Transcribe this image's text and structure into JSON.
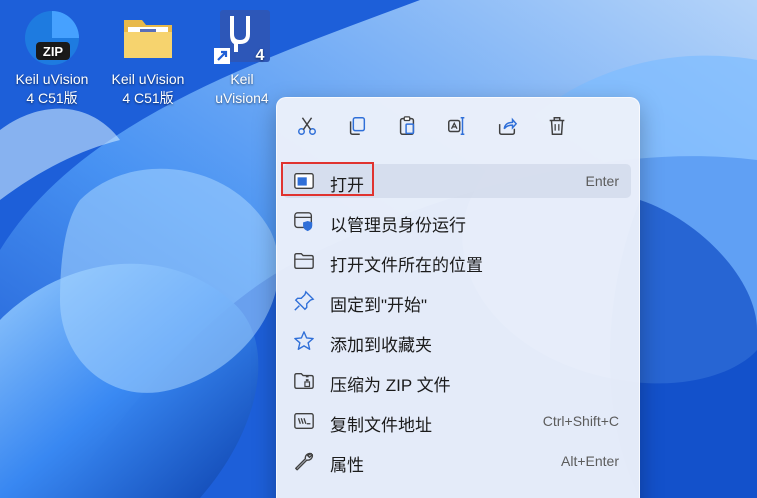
{
  "desktop": {
    "icons": [
      {
        "label": "Keil uVision\n4 C51版",
        "type": "zip-archive"
      },
      {
        "label": "Keil uVision\n4 C51版",
        "type": "folder"
      },
      {
        "label": "Keil\nuVision4",
        "type": "keil-shortcut",
        "badge": "4"
      }
    ]
  },
  "context_menu": {
    "quick_actions": [
      {
        "name": "cut",
        "icon": "scissors-icon"
      },
      {
        "name": "copy",
        "icon": "copy-icon"
      },
      {
        "name": "paste",
        "icon": "clipboard-icon"
      },
      {
        "name": "rename",
        "icon": "rename-icon"
      },
      {
        "name": "share",
        "icon": "share-icon"
      },
      {
        "name": "delete",
        "icon": "trash-icon"
      }
    ],
    "items": [
      {
        "label": "打开",
        "shortcut": "Enter",
        "icon": "window-icon"
      },
      {
        "label": "以管理员身份运行",
        "shortcut": "",
        "icon": "admin-shield-icon"
      },
      {
        "label": "打开文件所在的位置",
        "shortcut": "",
        "icon": "folder-icon"
      },
      {
        "label": "固定到\"开始\"",
        "shortcut": "",
        "icon": "pin-icon"
      },
      {
        "label": "添加到收藏夹",
        "shortcut": "",
        "icon": "star-icon"
      },
      {
        "label": "压缩为 ZIP 文件",
        "shortcut": "",
        "icon": "zip-folder-icon"
      },
      {
        "label": "复制文件地址",
        "shortcut": "Ctrl+Shift+C",
        "icon": "path-icon"
      },
      {
        "label": "属性",
        "shortcut": "Alt+Enter",
        "icon": "wrench-icon"
      }
    ]
  },
  "colors": {
    "highlight": "#e0332f",
    "accent": "#2f6fd8"
  }
}
